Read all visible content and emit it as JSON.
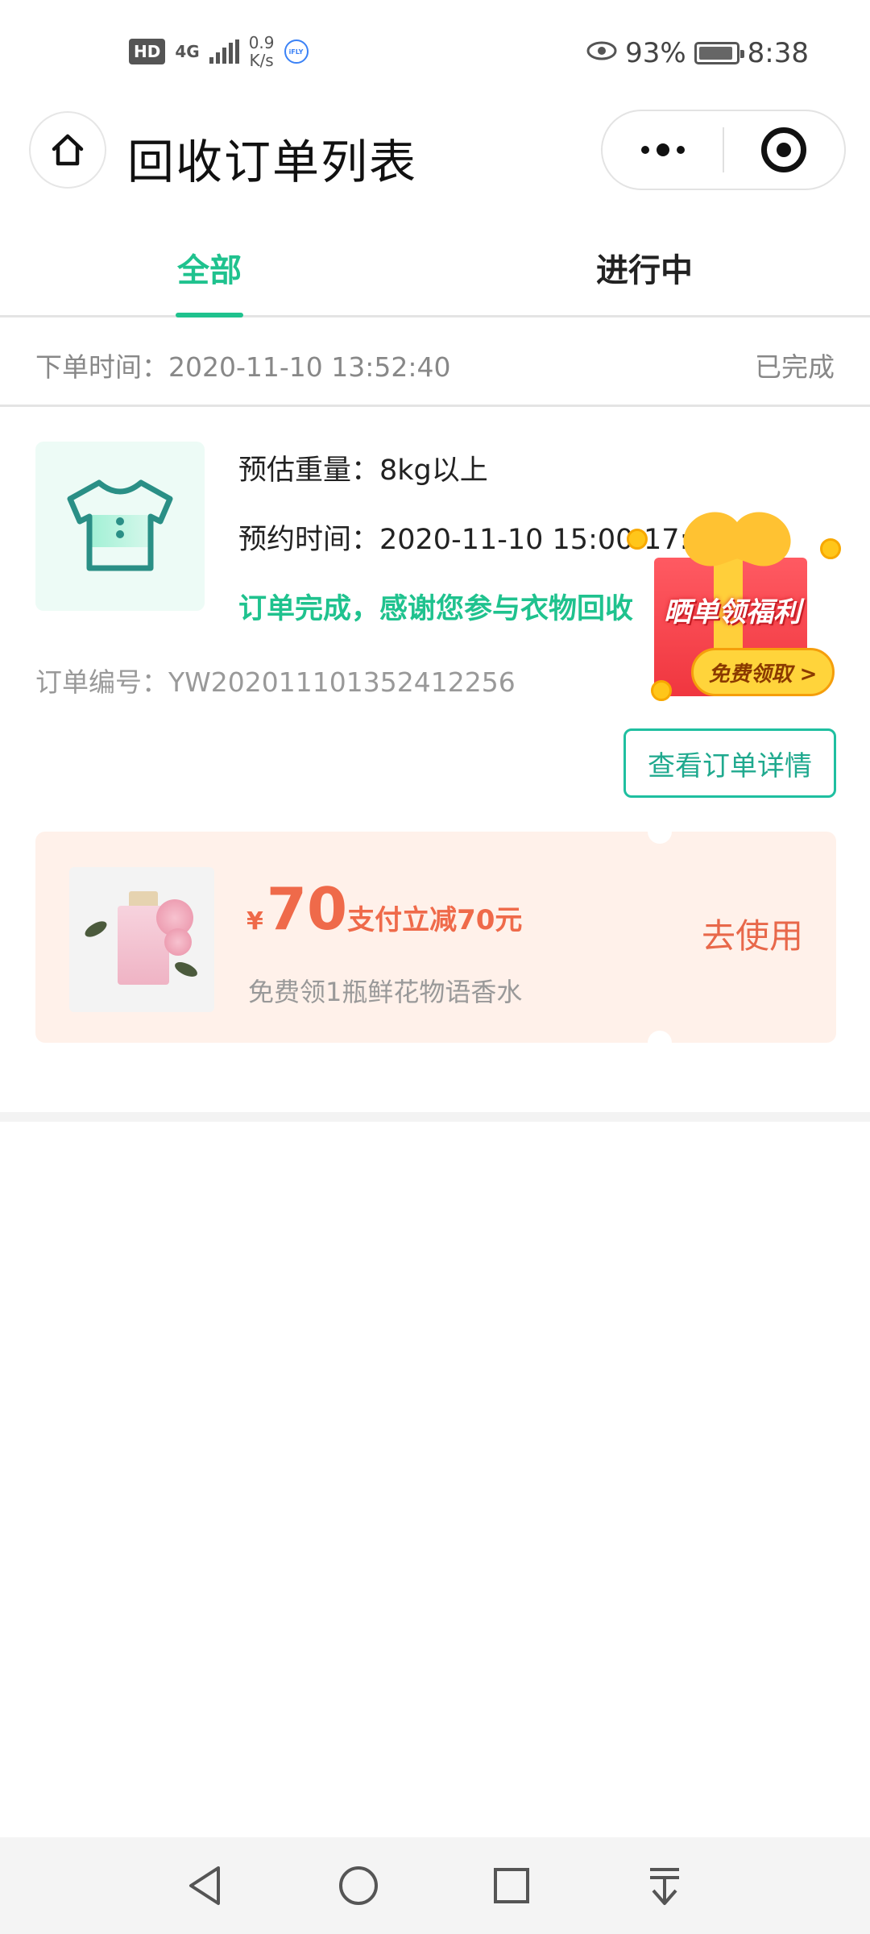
{
  "status_bar": {
    "hd": "HD",
    "network": "4G",
    "speed_value": "0.9",
    "speed_unit": "K/s",
    "app_badge": "iFLY",
    "battery_percent": "93%",
    "time": "8:38"
  },
  "nav": {
    "title": "回收订单列表"
  },
  "tabs": [
    {
      "label": "全部",
      "active": true
    },
    {
      "label": "进行中",
      "active": false
    }
  ],
  "order": {
    "time_label": "下单时间：2020-11-10 13:52:40",
    "status": "已完成",
    "weight": "预估重量：8kg以上",
    "appointment": "预约时间：2020-11-10 15:00-17:00",
    "completion_msg": "订单完成，感谢您参与衣物回收",
    "order_no": "订单编号：YW202011101352412256",
    "detail_button": "查看订单详情"
  },
  "promo_badge": {
    "title": "晒单领福利",
    "button": "免费领取 >"
  },
  "coupon": {
    "currency": "¥",
    "amount": "70",
    "desc": "支付立减70元",
    "subtitle": "免费领1瓶鲜花物语香水",
    "button": "去使用"
  },
  "colors": {
    "accent": "#1fc28e",
    "coupon_bg": "#fff1ea",
    "coupon_text": "#ef6a4a"
  }
}
